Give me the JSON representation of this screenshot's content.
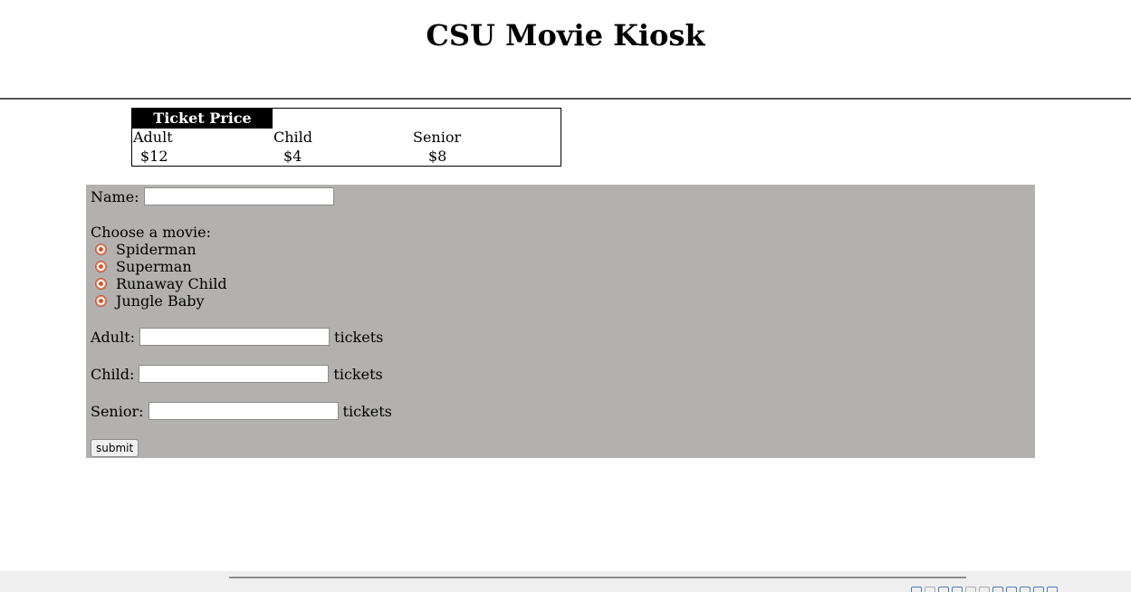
{
  "page": {
    "title": "CSU Movie Kiosk"
  },
  "price_table": {
    "header": "Ticket Price",
    "categories": [
      {
        "label": "Adult",
        "price": "$12"
      },
      {
        "label": "Child",
        "price": "$4"
      },
      {
        "label": "Senior",
        "price": "$8"
      }
    ]
  },
  "form": {
    "name_label": "Name:",
    "name_value": "",
    "choose_label": "Choose a movie:",
    "movies": [
      {
        "label": "Spiderman"
      },
      {
        "label": "Superman"
      },
      {
        "label": "Runaway Child"
      },
      {
        "label": "Jungle Baby"
      }
    ],
    "adult_label": "Adult:",
    "child_label": "Child:",
    "senior_label": "Senior:",
    "tickets_suffix": "tickets",
    "adult_value": "",
    "child_value": "",
    "senior_value": "",
    "submit_label": "submit"
  },
  "colors": {
    "panel_background": "#b2b1af",
    "header_background": "#000000",
    "radio_accent": "#d9552c"
  }
}
